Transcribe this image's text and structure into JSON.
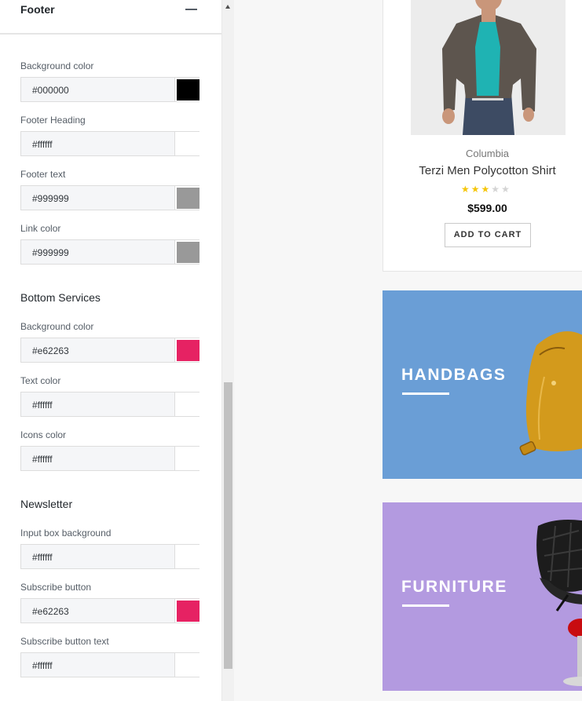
{
  "panel": {
    "title": "Footer",
    "sections": [
      {
        "title": "",
        "fields": [
          {
            "label": "Background color",
            "value": "#000000",
            "swatch": "#000000"
          },
          {
            "label": "Footer Heading",
            "value": "#ffffff",
            "swatch": "#ffffff"
          },
          {
            "label": "Footer text",
            "value": "#999999",
            "swatch": "#999999"
          },
          {
            "label": "Link color",
            "value": "#999999",
            "swatch": "#999999"
          }
        ]
      },
      {
        "title": "Bottom Services",
        "fields": [
          {
            "label": "Background color",
            "value": "#e62263",
            "swatch": "#e62263"
          },
          {
            "label": "Text color",
            "value": "#ffffff",
            "swatch": "#ffffff"
          },
          {
            "label": "Icons color",
            "value": "#ffffff",
            "swatch": "#ffffff"
          }
        ]
      },
      {
        "title": "Newsletter",
        "fields": [
          {
            "label": "Input box background",
            "value": "#ffffff",
            "swatch": "#ffffff"
          },
          {
            "label": "Subscribe button",
            "value": "#e62263",
            "swatch": "#e62263"
          },
          {
            "label": "Subscribe button text",
            "value": "#ffffff",
            "swatch": "#ffffff"
          }
        ]
      }
    ]
  },
  "preview": {
    "product": {
      "brand": "Columbia",
      "name": "Terzi Men Polycotton Shirt",
      "rating": 3,
      "rating_max": 5,
      "star_glyph": "★",
      "price": "$599.00",
      "cart_label": "ADD TO CART"
    },
    "banners": [
      {
        "title": "HANDBAGS",
        "color": "#6a9ed6"
      },
      {
        "title": "FURNITURE",
        "color": "#b39ae0"
      }
    ]
  }
}
